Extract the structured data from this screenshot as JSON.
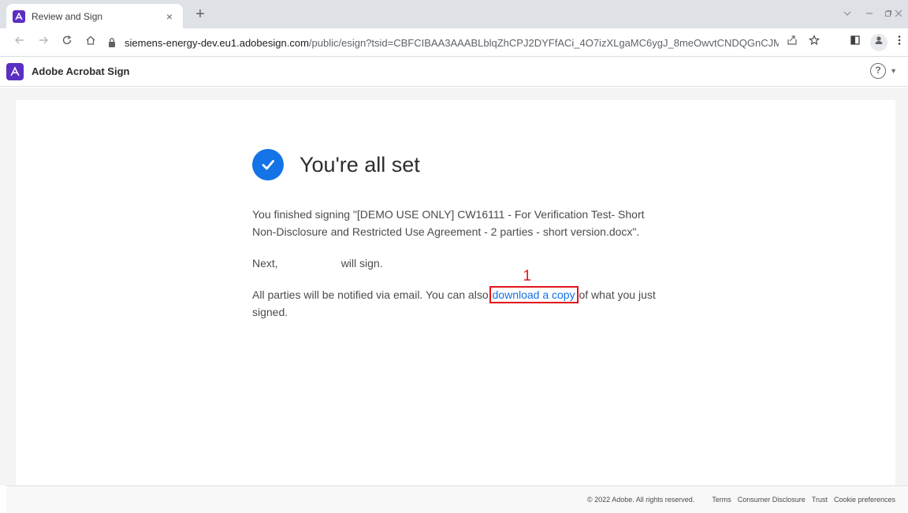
{
  "browser": {
    "tab": {
      "title": "Review and Sign",
      "close_glyph": "×"
    },
    "new_tab_glyph": "+",
    "url_host": "siemens-energy-dev.eu1.adobesign.com",
    "url_path": "/public/esign?tsid=CBFCIBAA3AAABLblqZhCPJ2DYFfACi_4O7izXLgaMC6ygJ_8meOwvtCNDQGnCJMLBFQ0K4..."
  },
  "icons": {
    "back": "arrow-left-icon",
    "forward": "arrow-right-icon",
    "reload": "reload-icon",
    "home": "home-icon",
    "lock": "lock-icon",
    "share": "share-icon",
    "star": "star-icon",
    "sidepanel": "side-panel-icon",
    "profile": "profile-icon",
    "menu": "kebab-menu-icon"
  },
  "app": {
    "name": "Adobe Acrobat Sign",
    "help_glyph": "?",
    "accent_color": "#1473e6",
    "brand_color": "#5a2fc2"
  },
  "confirmation": {
    "heading": "You're all set",
    "finished_text": "You finished signing \"[DEMO USE ONLY] CW16111 - For Verification Test- Short Non-Disclosure and Restricted Use Agreement - 2 parties - short version.docx\".",
    "next_prefix": "Next,",
    "next_suffix": "will sign.",
    "notify_prefix": "All parties will be notified via email. You can also",
    "download_link": "download a copy",
    "notify_suffix": "of what you just signed.",
    "annotation_marker": "1"
  },
  "footer": {
    "copyright": "© 2022 Adobe. All rights reserved.",
    "links": [
      "Terms",
      "Consumer Disclosure",
      "Trust",
      "Cookie preferences"
    ]
  }
}
